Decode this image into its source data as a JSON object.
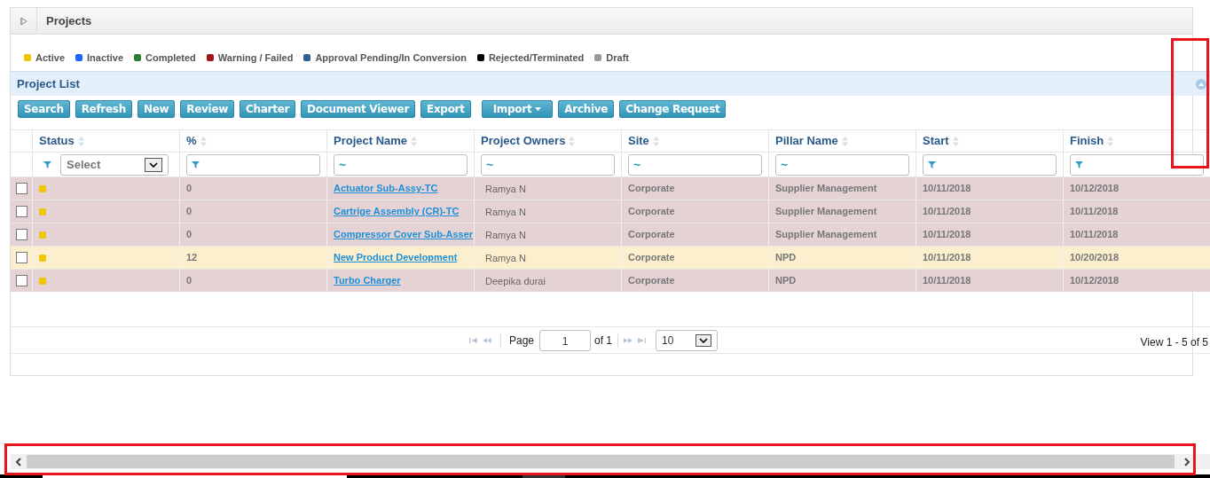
{
  "panel": {
    "title": "Projects",
    "expanded": false
  },
  "legend": [
    {
      "label": "Active",
      "color": "#f2c500"
    },
    {
      "label": "Inactive",
      "color": "#1a66ff"
    },
    {
      "label": "Completed",
      "color": "#2e7d32"
    },
    {
      "label": "Warning / Failed",
      "color": "#a31515"
    },
    {
      "label": "Approval Pending/In Conversion",
      "color": "#2f5f94"
    },
    {
      "label": "Rejected/Terminated",
      "color": "#000000"
    },
    {
      "label": "Draft",
      "color": "#999999"
    }
  ],
  "list": {
    "title": "Project List",
    "expanded": true
  },
  "toolbar": [
    {
      "label": "Search",
      "kind": "plain"
    },
    {
      "label": "Refresh",
      "kind": "plain"
    },
    {
      "label": "New",
      "kind": "plain"
    },
    {
      "label": "Review",
      "kind": "plain"
    },
    {
      "label": "Charter",
      "kind": "plain"
    },
    {
      "label": "Document Viewer",
      "kind": "plain"
    },
    {
      "label": "Export",
      "kind": "plain"
    },
    {
      "label": "Import",
      "kind": "dropdown"
    },
    {
      "label": "Archive",
      "kind": "plain"
    },
    {
      "label": "Change Request",
      "kind": "plain"
    }
  ],
  "table": {
    "columns": [
      {
        "label": "Status",
        "filter": {
          "kind": "select",
          "value": "Select"
        }
      },
      {
        "label": "%",
        "filter": {
          "kind": "funnel"
        }
      },
      {
        "label": "Project Name",
        "filter": {
          "kind": "text",
          "symbol": "~"
        }
      },
      {
        "label": "Project Owners",
        "filter": {
          "kind": "text",
          "symbol": "~"
        }
      },
      {
        "label": "Site",
        "filter": {
          "kind": "text",
          "symbol": "~"
        }
      },
      {
        "label": "Pillar Name",
        "filter": {
          "kind": "text",
          "symbol": "~"
        }
      },
      {
        "label": "Start",
        "filter": {
          "kind": "funnel"
        }
      },
      {
        "label": "Finish",
        "filter": {
          "kind": "funnel"
        }
      }
    ],
    "rows": [
      {
        "checked": false,
        "selected": false,
        "color": "#f2c500",
        "percent": "0",
        "name": "Actuator Sub-Assy-TC",
        "owner": "Ramya N",
        "site": "Corporate",
        "pillar": "Supplier Management",
        "start": "10/11/2018",
        "finish": "10/12/2018"
      },
      {
        "checked": false,
        "selected": false,
        "color": "#f2c500",
        "percent": "0",
        "name": "Cartrige Assembly (CR)-TC",
        "owner": "Ramya N",
        "site": "Corporate",
        "pillar": "Supplier Management",
        "start": "10/11/2018",
        "finish": "10/11/2018"
      },
      {
        "checked": false,
        "selected": false,
        "color": "#f2c500",
        "percent": "0",
        "name": "Compressor Cover Sub-Asser",
        "owner": "Ramya N",
        "site": "Corporate",
        "pillar": "Supplier Management",
        "start": "10/11/2018",
        "finish": "10/11/2018"
      },
      {
        "checked": false,
        "selected": true,
        "color": "#f2c500",
        "percent": "12",
        "name": "New Product Development",
        "owner": "Ramya N",
        "site": "Corporate",
        "pillar": "NPD",
        "start": "10/11/2018",
        "finish": "10/20/2018"
      },
      {
        "checked": false,
        "selected": false,
        "color": "#f2c500",
        "percent": "0",
        "name": "Turbo Charger",
        "owner": "Deepika durai",
        "site": "Corporate",
        "pillar": "NPD",
        "start": "10/11/2018",
        "finish": "10/12/2018"
      }
    ]
  },
  "pager": {
    "page_label": "Page",
    "page": "1",
    "of_label": "of 1",
    "page_size": "10",
    "summary": "View 1 - 5 of 5"
  }
}
